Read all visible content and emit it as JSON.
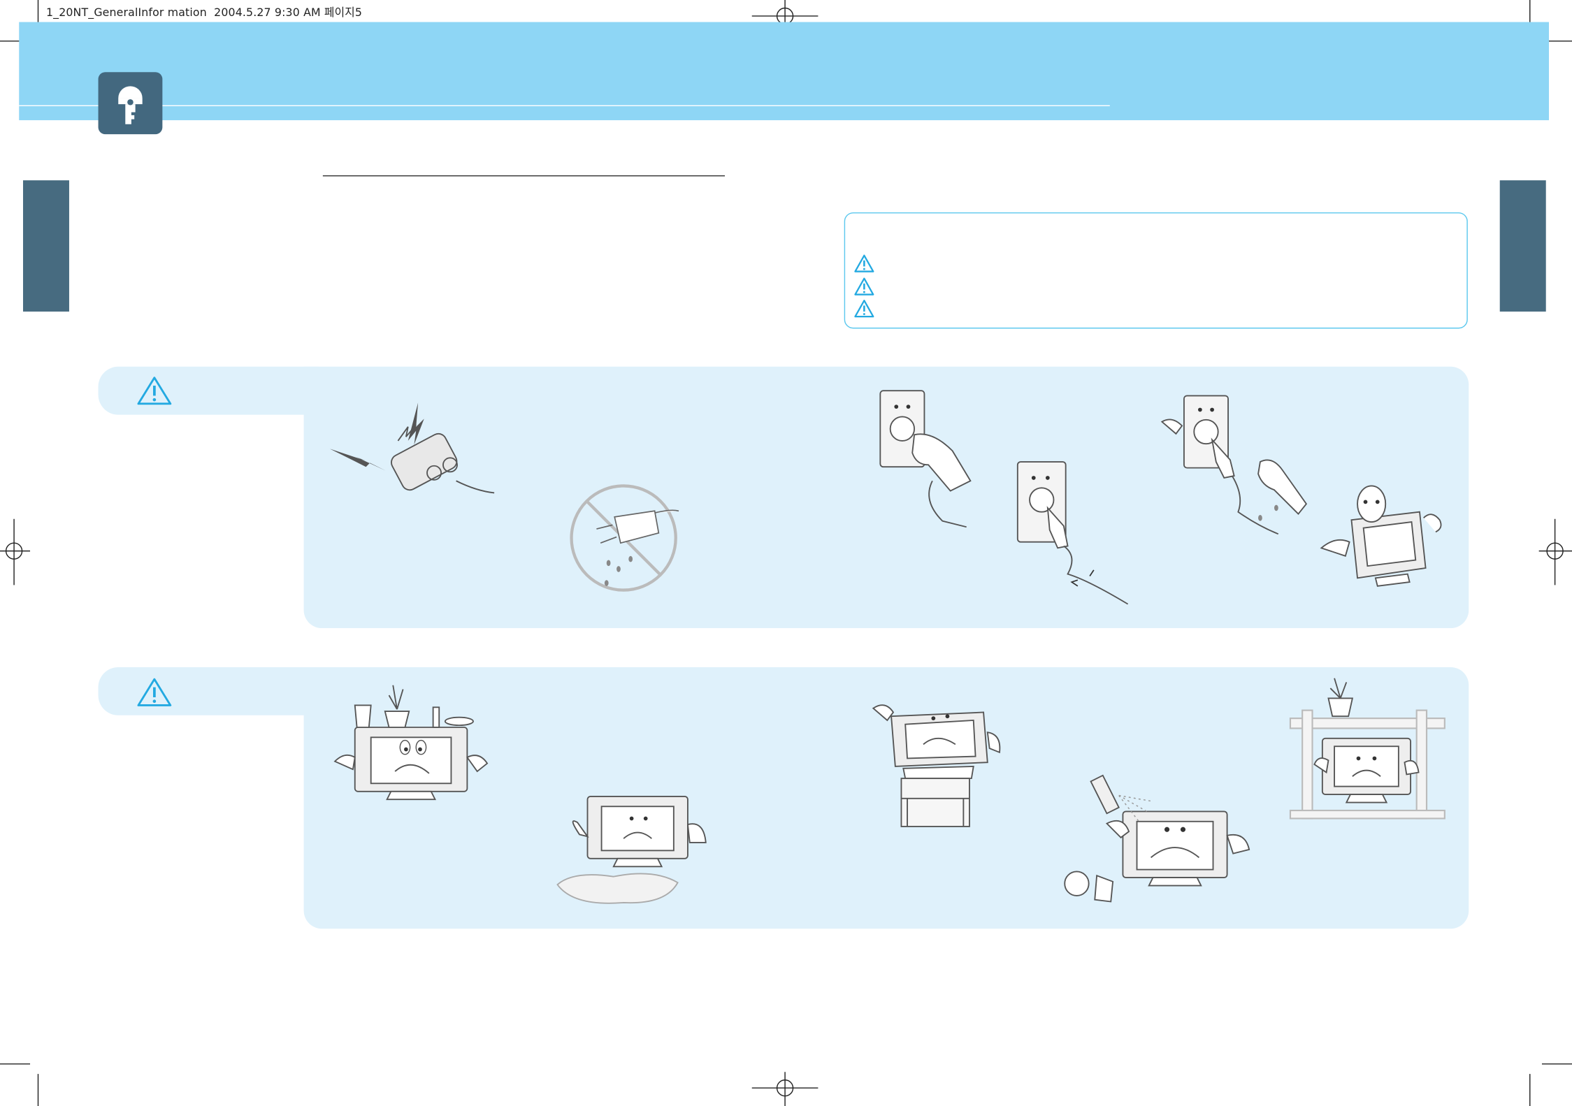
{
  "slug_line": "1_20NT_GeneralInfor mation  2004.5.27 9:30 AM 페이지5",
  "colors": {
    "banner": "#8ed6f5",
    "tab": "#476b80",
    "panel": "#dff1fb",
    "warning": "#23a9e1",
    "infobox_border": "#5cc8ee"
  },
  "icons": {
    "header": "key-icon",
    "warning": "warning-triangle-icon"
  },
  "info_box": {
    "warning_markers": [
      "warning-triangle-icon",
      "warning-triangle-icon",
      "warning-triangle-icon"
    ]
  },
  "sections": [
    {
      "id": "power",
      "icon": "warning-triangle-icon",
      "illustrations": [
        "sparking-power-strip",
        "wet-plug-prohibited",
        "hand-plugging-into-outlet",
        "damaged-cord-at-outlet",
        "wet-hand-touching-plug",
        "tv-tipping-over"
      ]
    },
    {
      "id": "installation",
      "icon": "warning-triangle-icon",
      "illustrations": [
        "objects-on-top-of-tv",
        "tv-above-puddle",
        "tv-on-unstable-stand",
        "spray-near-tv",
        "tv-in-enclosed-shelf"
      ]
    }
  ]
}
